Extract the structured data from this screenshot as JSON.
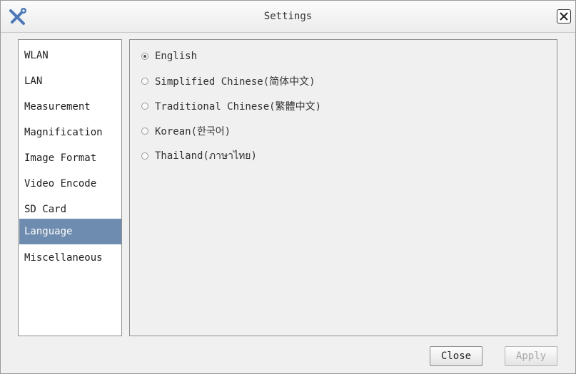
{
  "window": {
    "title": "Settings"
  },
  "sidebar": {
    "items": [
      {
        "label": "WLAN"
      },
      {
        "label": "LAN"
      },
      {
        "label": "Measurement"
      },
      {
        "label": "Magnification"
      },
      {
        "label": "Image Format"
      },
      {
        "label": "Video Encode"
      },
      {
        "label": "SD Card"
      },
      {
        "label": "Language",
        "selected": true
      },
      {
        "label": "Miscellaneous"
      }
    ]
  },
  "language": {
    "options": [
      {
        "label": "English",
        "checked": true
      },
      {
        "label": "Simplified Chinese(简体中文)",
        "checked": false
      },
      {
        "label": "Traditional Chinese(繁體中文)",
        "checked": false
      },
      {
        "label": "Korean(한국어)",
        "checked": false
      },
      {
        "label": "Thailand(ภาษาไทย)",
        "checked": false
      }
    ]
  },
  "buttons": {
    "close": "Close",
    "apply": "Apply"
  },
  "colors": {
    "selected_bg": "#6e8cb0",
    "app_icon": "#4a78b8"
  }
}
